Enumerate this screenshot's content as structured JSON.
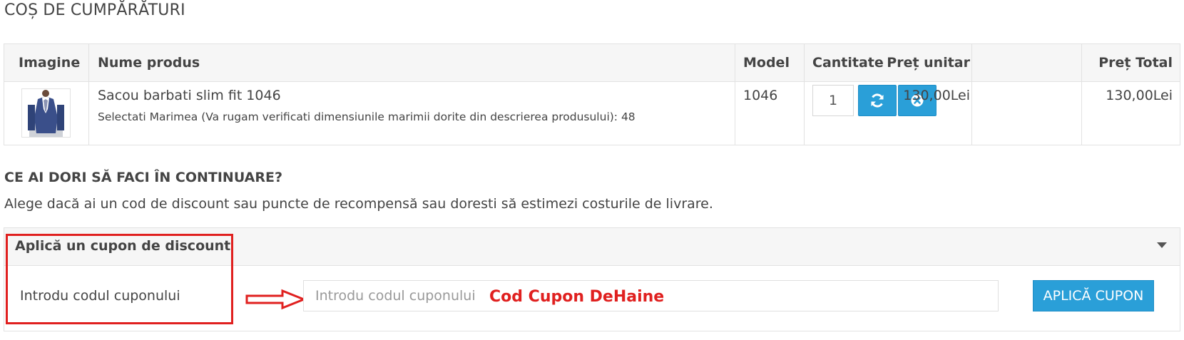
{
  "page": {
    "title": "COȘ DE CUMPĂRĂTURI"
  },
  "cart": {
    "headers": {
      "image": "Imagine",
      "name": "Nume produs",
      "model": "Model",
      "quantity": "Cantitate",
      "unit_price": "Preț unitar",
      "total_price": "Preț Total"
    },
    "item": {
      "name": "Sacou barbati slim fit 1046",
      "option": "Selectati Marimea (Va rugam verificati dimensiunile marimii dorite din descrierea produsului): 48",
      "model": "1046",
      "quantity": "1",
      "unit_price": "130,00Lei",
      "total_price": "130,00Lei"
    },
    "icons": {
      "update": "refresh-icon",
      "remove": "remove-circle-icon"
    }
  },
  "next_steps": {
    "title": "CE AI DORI SĂ FACI ÎN CONTINUARE?",
    "description": "Alege dacă ai un cod de discount sau puncte de recompensă sau doresti să estimezi costurile de livrare."
  },
  "coupon": {
    "panel_title": "Aplică un cupon de discount",
    "label": "Introdu codul cuponului",
    "placeholder": "Introdu codul cuponului",
    "value": "",
    "apply_label": "APLICĂ CUPON",
    "annotation": "Cod Cupon DeHaine"
  },
  "colors": {
    "accent": "#2a9fd8",
    "annotation_red": "#e0201f"
  }
}
